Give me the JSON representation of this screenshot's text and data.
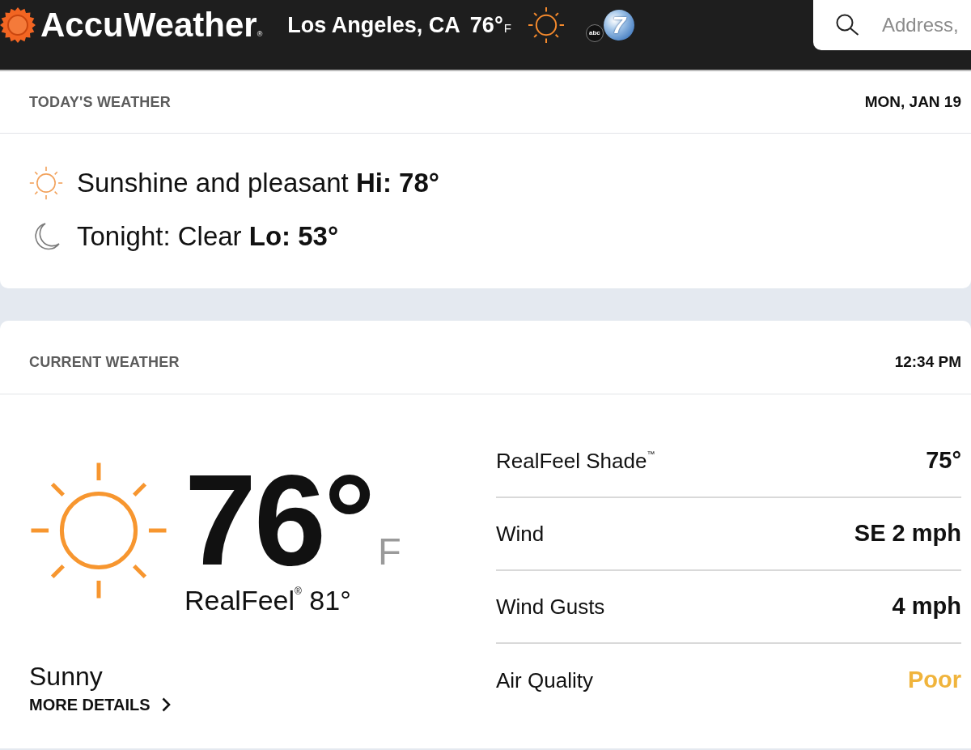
{
  "header": {
    "brand": "AccuWeather$_{®}$",
    "location": "Los Angeles, CA",
    "temperature": "76°",
    "unit": "F",
    "station_logo": {
      "network": "abc",
      "channel": "7"
    },
    "search": {
      "placeholder": "Address,"
    }
  },
  "today": {
    "title": "TODAY'S WEATHER",
    "date": "MON, JAN 19",
    "forecasts": [
      {
        "kind": "day",
        "text": "Sunshine and pleasant **Hi: 78°**"
      },
      {
        "kind": "night",
        "text": "Tonight: Clear **Lo: 53°**"
      }
    ]
  },
  "current": {
    "title": "CURRENT WEATHER",
    "time": "12:34 PM",
    "temperature": "76°",
    "unit": "F",
    "realfeel": "RealFeel$^{®}$ 81°",
    "condition": "Sunny",
    "details_link": "MORE DETAILS",
    "details": [
      {
        "label": "RealFeel Shade$^{™}$",
        "value": "75°",
        "color": "#111111"
      },
      {
        "label": "Wind",
        "value": "SE 2 mph",
        "color": "#111111"
      },
      {
        "label": "Wind Gusts",
        "value": "4 mph",
        "color": "#111111"
      },
      {
        "label": "Air Quality",
        "value": "Poor",
        "color": "#f0b43c"
      }
    ]
  }
}
